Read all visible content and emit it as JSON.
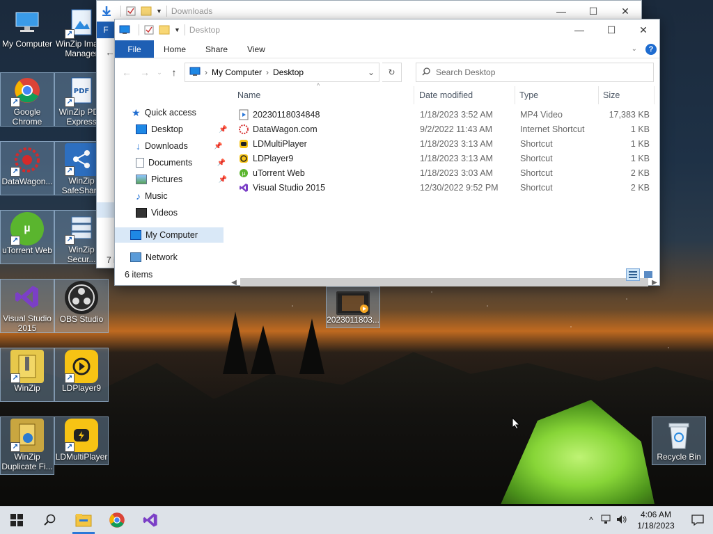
{
  "desktop": {
    "icons": [
      {
        "label": "My Computer"
      },
      {
        "label": "WinZip Image Manager"
      },
      {
        "label": "Google Chrome"
      },
      {
        "label": "WinZip PDF Express"
      },
      {
        "label": "DataWagon..."
      },
      {
        "label": "WinZip SafeShare"
      },
      {
        "label": "uTorrent Web"
      },
      {
        "label": "WinZip Secur..."
      },
      {
        "label": "Visual Studio 2015"
      },
      {
        "label": "OBS Studio"
      },
      {
        "label": "WinZip"
      },
      {
        "label": "LDPlayer9"
      },
      {
        "label": "WinZip Duplicate Fi..."
      },
      {
        "label": "LDMultiPlayer"
      },
      {
        "label": "2023011803..."
      },
      {
        "label": "Recycle Bin"
      }
    ]
  },
  "back_window": {
    "title": "Downloads",
    "file_tab": "F",
    "status_partial": "7 i"
  },
  "front_window": {
    "title": "Desktop",
    "ribbon": {
      "file": "File",
      "home": "Home",
      "share": "Share",
      "view": "View",
      "help": "?"
    },
    "address": {
      "root": "My Computer",
      "current": "Desktop"
    },
    "search_placeholder": "Search Desktop",
    "nav": {
      "quick_access": "Quick access",
      "desktop": "Desktop",
      "downloads": "Downloads",
      "documents": "Documents",
      "pictures": "Pictures",
      "music": "Music",
      "videos": "Videos",
      "my_computer": "My Computer",
      "network": "Network"
    },
    "columns": {
      "name": "Name",
      "date": "Date modified",
      "type": "Type",
      "size": "Size"
    },
    "files": [
      {
        "name": "20230118034848",
        "date": "1/18/2023 3:52 AM",
        "type": "MP4 Video",
        "size": "17,383 KB"
      },
      {
        "name": "DataWagon.com",
        "date": "9/2/2022 11:43 AM",
        "type": "Internet Shortcut",
        "size": "1 KB"
      },
      {
        "name": "LDMultiPlayer",
        "date": "1/18/2023 3:13 AM",
        "type": "Shortcut",
        "size": "1 KB"
      },
      {
        "name": "LDPlayer9",
        "date": "1/18/2023 3:13 AM",
        "type": "Shortcut",
        "size": "1 KB"
      },
      {
        "name": "uTorrent Web",
        "date": "1/18/2023 3:03 AM",
        "type": "Shortcut",
        "size": "2 KB"
      },
      {
        "name": "Visual Studio 2015",
        "date": "12/30/2022 9:52 PM",
        "type": "Shortcut",
        "size": "2 KB"
      }
    ],
    "status": "6 items"
  },
  "taskbar": {
    "time": "4:06 AM",
    "date": "1/18/2023"
  }
}
